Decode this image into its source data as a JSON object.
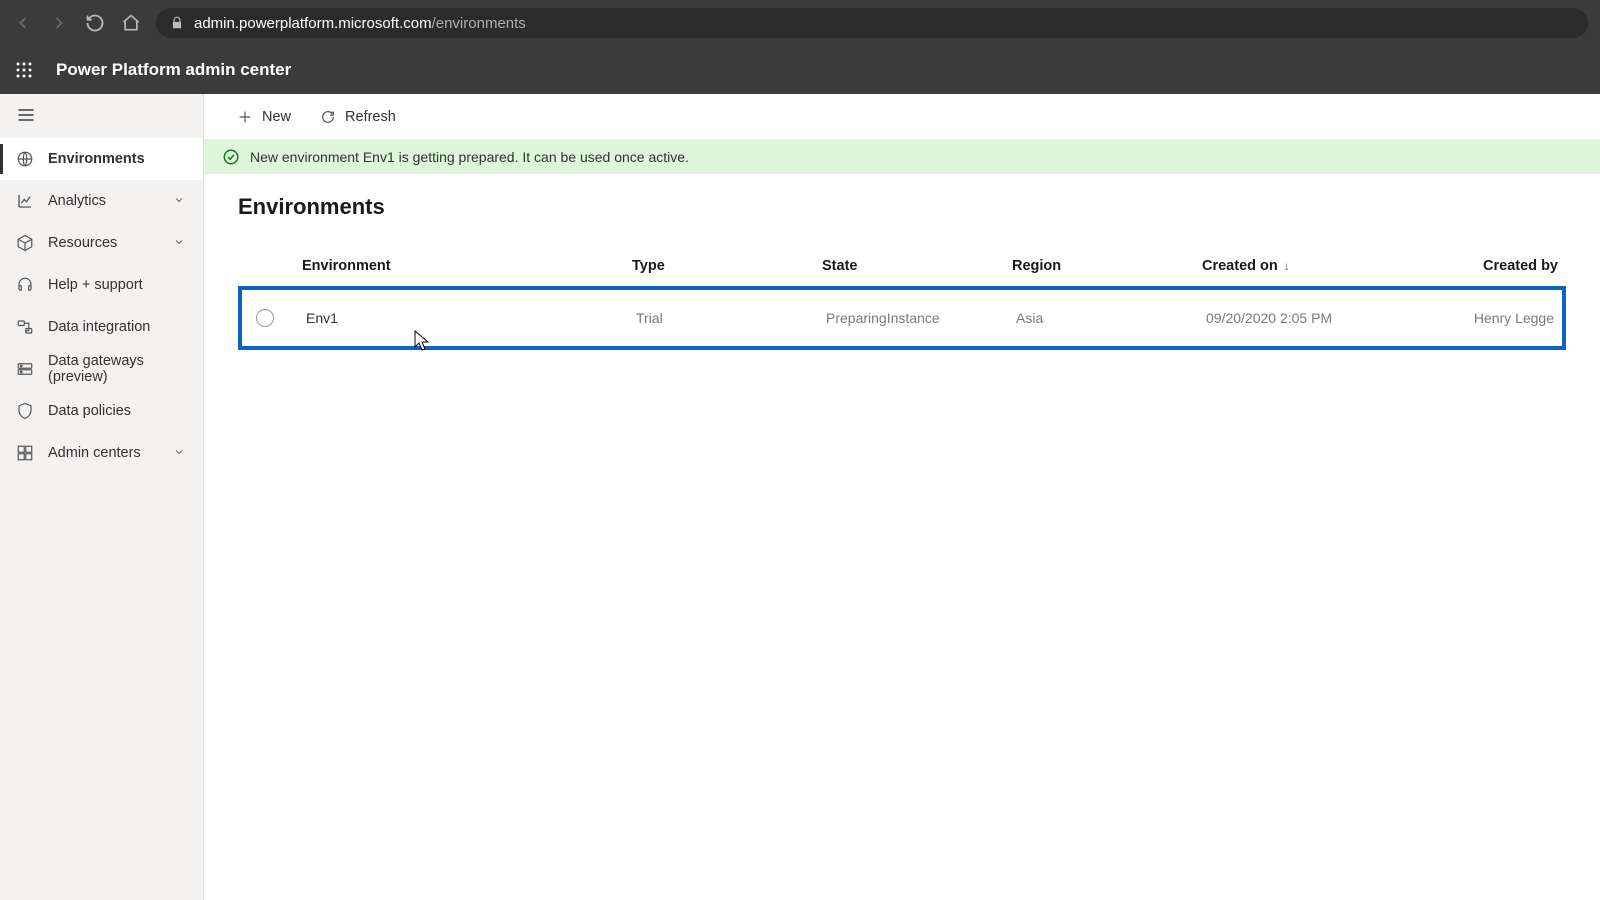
{
  "browser": {
    "url_domain": "admin.powerplatform.microsoft.com",
    "url_path": "/environments"
  },
  "app": {
    "title": "Power Platform admin center"
  },
  "sidebar": {
    "items": [
      {
        "label": "Environments",
        "expandable": false
      },
      {
        "label": "Analytics",
        "expandable": true
      },
      {
        "label": "Resources",
        "expandable": true
      },
      {
        "label": "Help + support",
        "expandable": false
      },
      {
        "label": "Data integration",
        "expandable": false
      },
      {
        "label": "Data gateways (preview)",
        "expandable": false
      },
      {
        "label": "Data policies",
        "expandable": false
      },
      {
        "label": "Admin centers",
        "expandable": true
      }
    ]
  },
  "commands": {
    "new": "New",
    "refresh": "Refresh"
  },
  "banner": {
    "text": "New environment Env1 is getting prepared. It can be used once active."
  },
  "page": {
    "title": "Environments"
  },
  "table": {
    "headers": {
      "environment": "Environment",
      "type": "Type",
      "state": "State",
      "region": "Region",
      "created_on": "Created on",
      "created_by": "Created by"
    },
    "sort_indicator": "↓",
    "rows": [
      {
        "environment": "Env1",
        "type": "Trial",
        "state": "PreparingInstance",
        "region": "Asia",
        "created_on": "09/20/2020 2:05 PM",
        "created_by": "Henry Legge"
      }
    ]
  }
}
